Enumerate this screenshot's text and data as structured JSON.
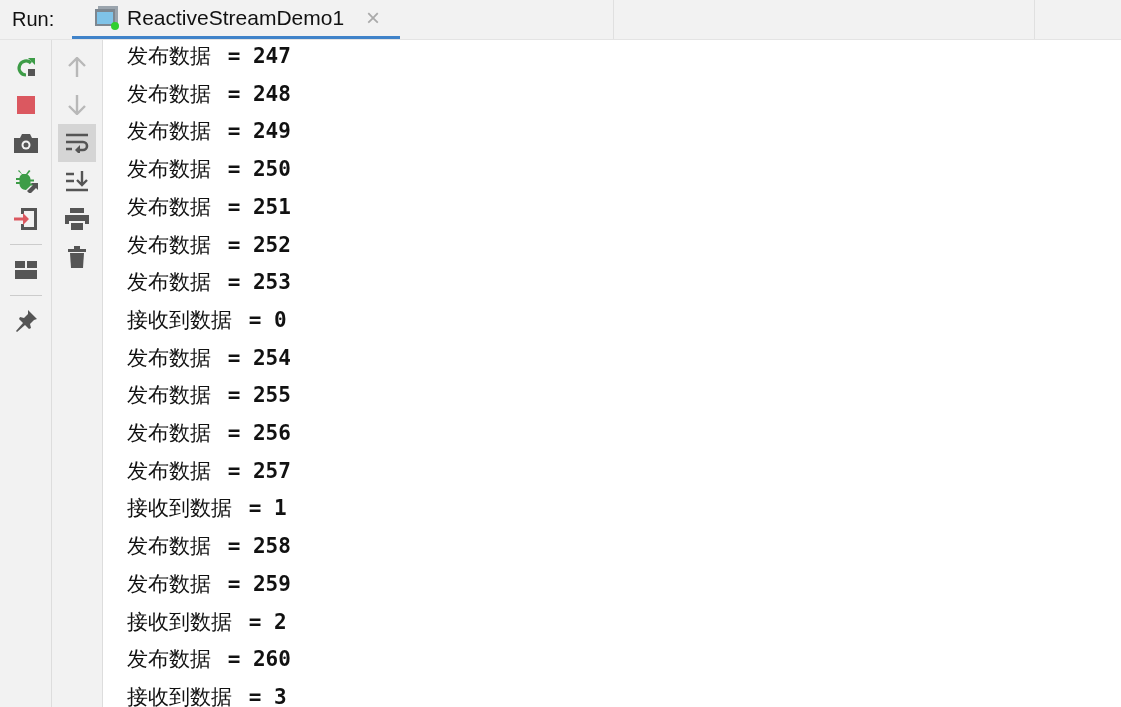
{
  "panel": {
    "title": "Run:"
  },
  "tabs": [
    {
      "label": "ReactiveStreamDemo1",
      "selected": true,
      "running": true,
      "close": "×"
    }
  ],
  "left_toolbar_groups": [
    [
      {
        "kind": "rerun"
      },
      {
        "kind": "stop"
      },
      {
        "kind": "camera"
      },
      {
        "kind": "debug"
      },
      {
        "kind": "exit"
      }
    ],
    [
      {
        "kind": "layout"
      }
    ],
    [
      {
        "kind": "pin"
      }
    ]
  ],
  "right_toolbar": [
    {
      "kind": "up",
      "disabled": true,
      "selected": false
    },
    {
      "kind": "down",
      "disabled": true,
      "selected": false
    },
    {
      "kind": "wrap",
      "disabled": false,
      "selected": true
    },
    {
      "kind": "scroll-end",
      "disabled": false,
      "selected": false
    },
    {
      "kind": "print",
      "disabled": false,
      "selected": false
    },
    {
      "kind": "trash",
      "disabled": false,
      "selected": false
    }
  ],
  "console_lines": [
    "发布数据 **= 247**",
    "发布数据 **= 248**",
    "发布数据 **= 249**",
    "发布数据 **= 250**",
    "发布数据 **= 251**",
    "发布数据 **= 252**",
    "发布数据 **= 253**",
    "接收到数据 **= 0**",
    "发布数据 **= 254**",
    "发布数据 **= 255**",
    "发布数据 **= 256**",
    "发布数据 **= 257**",
    "接收到数据 **= 1**",
    "发布数据 **= 258**",
    "发布数据 **= 259**",
    "接收到数据 **= 2**",
    "发布数据 **= 260**",
    "接收到数据 **= 3**"
  ]
}
